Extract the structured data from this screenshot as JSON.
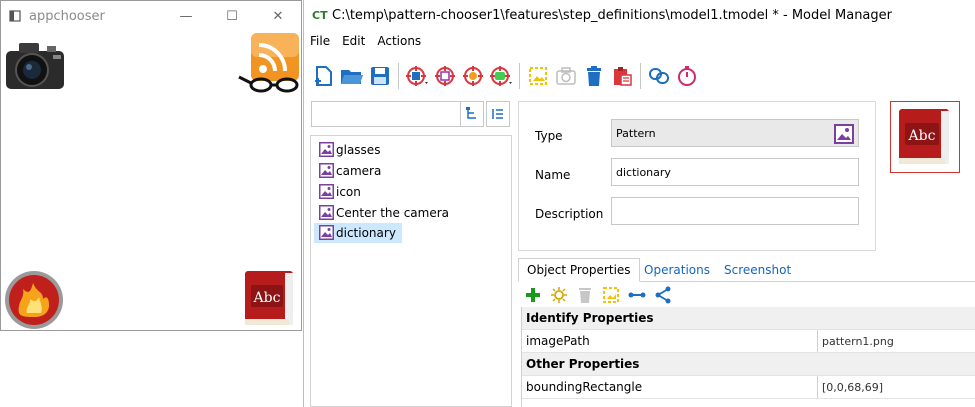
{
  "appchooser": {
    "title": "appchooser",
    "min_glyph": "—",
    "max_glyph": "☐",
    "close_glyph": "✕",
    "dictionary_text": "Abc"
  },
  "model_manager": {
    "logo": "CT",
    "title": "C:\\temp\\pattern-chooser1\\features\\step_definitions\\model1.tmodel * - Model Manager",
    "menu": [
      "File",
      "Edit",
      "Actions"
    ],
    "tree_items": [
      "glasses",
      "camera",
      "icon",
      "Center the camera",
      "dictionary"
    ],
    "selected_item": "dictionary",
    "details": {
      "type_label": "Type",
      "type_value": "Pattern",
      "name_label": "Name",
      "name_value": "dictionary",
      "description_label": "Description",
      "description_value": ""
    },
    "preview_text": "Abc",
    "tabs": [
      "Object Properties",
      "Operations",
      "Screenshot"
    ],
    "active_tab": "Object Properties",
    "property_groups": [
      {
        "category": "Identify Properties",
        "rows": [
          {
            "name": "imagePath",
            "value": "pattern1.png"
          }
        ]
      },
      {
        "category": "Other Properties",
        "rows": [
          {
            "name": "boundingRectangle",
            "value": "[0,0,68,69]"
          }
        ]
      }
    ]
  },
  "colors": {
    "accent_blue": "#1e6fbf",
    "toolbar_red": "#d9363e",
    "toolbar_purple": "#9b2fae",
    "toolbar_yellow": "#f0c400",
    "selection": "#cce8ff",
    "add_green": "#1a9a1a"
  },
  "icons": {
    "new": "new-file-icon",
    "open": "open-folder-icon",
    "save": "save-icon",
    "delete": "trash-icon",
    "link": "link-icon",
    "timer": "stopwatch-icon"
  }
}
